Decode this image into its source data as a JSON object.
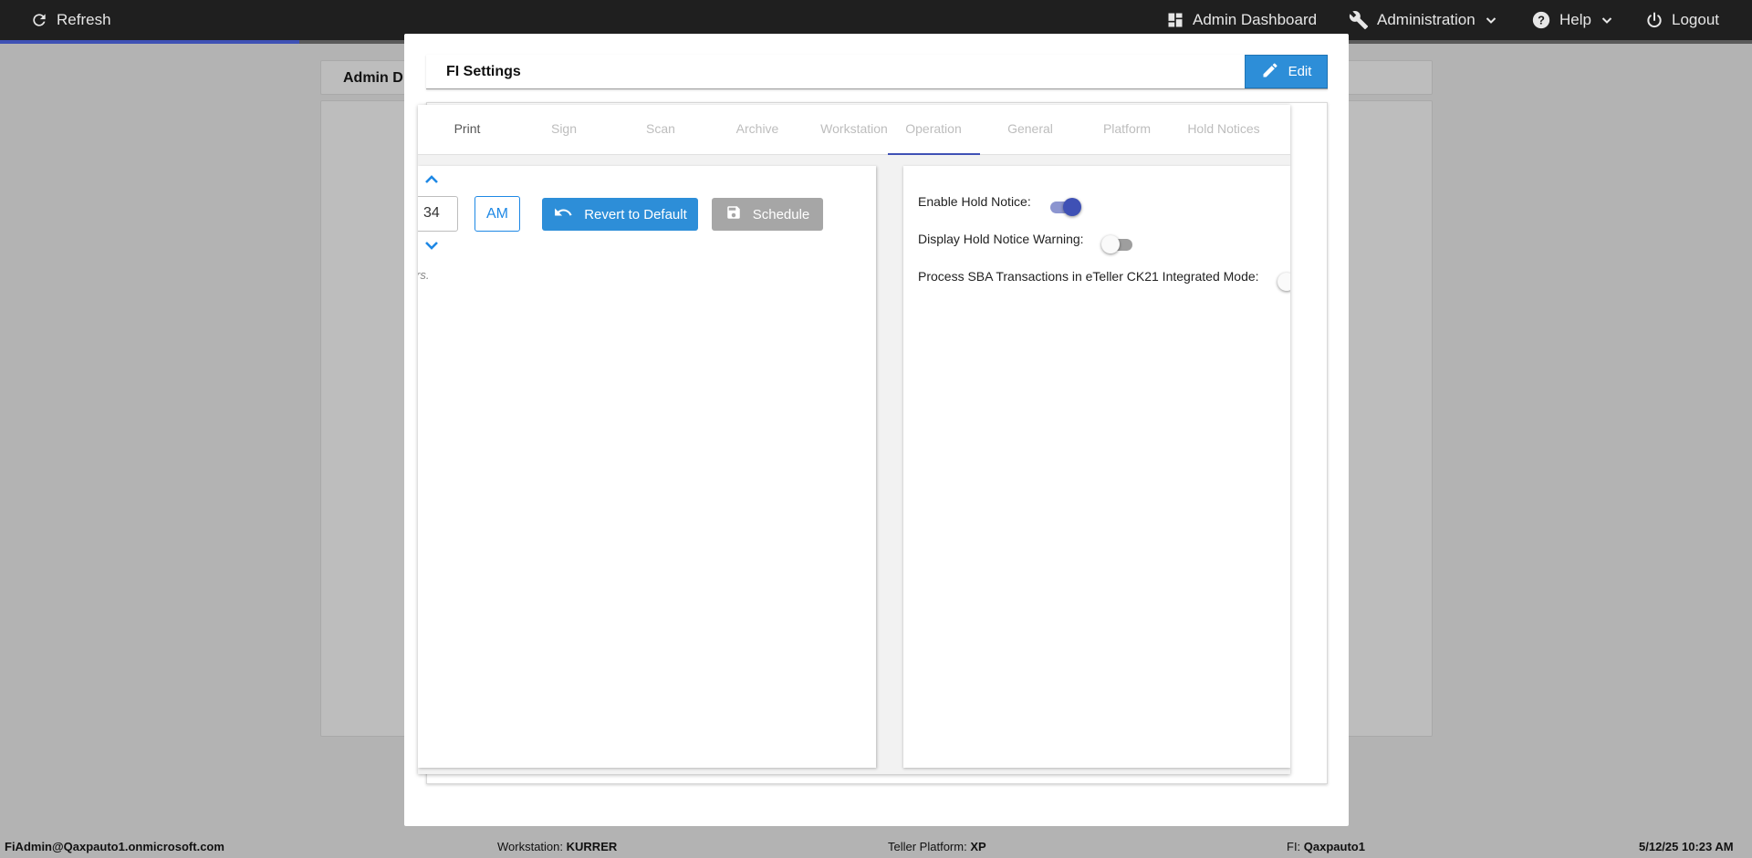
{
  "nav": {
    "refresh_label": "Refresh",
    "admin_dashboard_label": "Admin Dashboard",
    "administration_label": "Administration",
    "help_label": "Help",
    "logout_label": "Logout"
  },
  "background": {
    "header_title": "Admin D"
  },
  "modal": {
    "title": "FI Settings",
    "edit_label": "Edit",
    "tabs": [
      {
        "label": "Print"
      },
      {
        "label": "Sign"
      },
      {
        "label": "Scan"
      },
      {
        "label": "Archive"
      },
      {
        "label": "Workstation"
      },
      {
        "label": "Operation"
      },
      {
        "label": "General"
      },
      {
        "label": "Platform"
      },
      {
        "label": "Hold Notices"
      }
    ],
    "active_tab": "Operation",
    "left": {
      "minute_value": "34",
      "ampm_label": "AM",
      "revert_label": "Revert to Default",
      "schedule_label": "Schedule",
      "hint_text": "rs."
    },
    "right": {
      "settings": [
        {
          "label": "Enable Hold Notice:",
          "enabled": true
        },
        {
          "label": "Display Hold Notice Warning:",
          "enabled": false
        },
        {
          "label": "Process SBA Transactions in eTeller CK21 Integrated Mode:",
          "enabled": false
        }
      ]
    }
  },
  "footer": {
    "user": "FiAdmin@Qaxpauto1.onmicrosoft.com",
    "workstation_label": "Workstation:",
    "workstation_value": "KURRER",
    "platform_label": "Teller Platform:",
    "platform_value": "XP",
    "fi_label": "FI:",
    "fi_value": "Qaxpauto1",
    "datetime": "5/12/25 10:23 AM"
  },
  "colors": {
    "accent": "#3f51b5",
    "button_blue": "#2d8ed8",
    "topbar": "#1f1f1f"
  }
}
